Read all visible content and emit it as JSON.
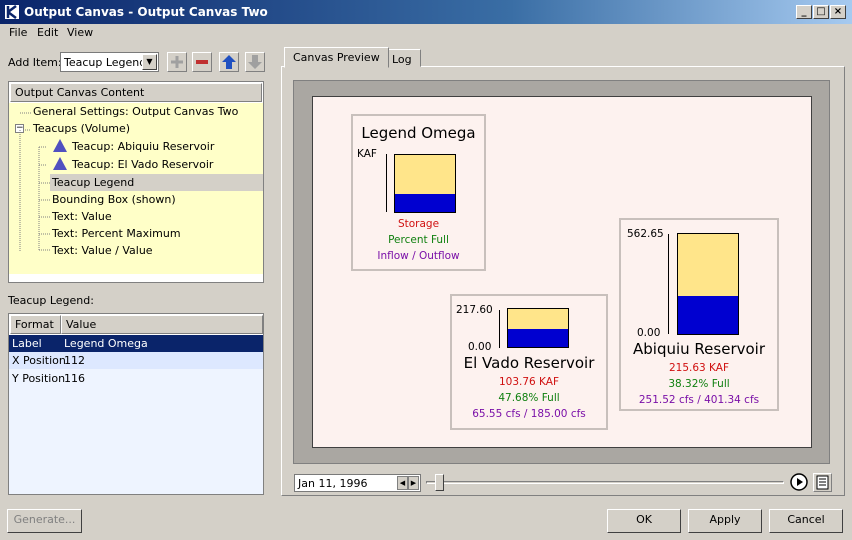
{
  "window": {
    "title": "Output Canvas - Output Canvas Two"
  },
  "menu": [
    "File",
    "Edit",
    "View"
  ],
  "add_item": {
    "label": "Add Item:",
    "selected": "Teacup Legend"
  },
  "content_tree": {
    "header": "Output Canvas Content",
    "items": [
      "General Settings: Output Canvas Two",
      "Teacups (Volume)",
      "Teacup: Abiquiu Reservoir",
      "Teacup: El Vado Reservoir",
      "Teacup Legend",
      "Bounding Box (shown)",
      "Text: Value",
      "Text: Percent Maximum",
      "Text: Value / Value"
    ],
    "collapse_glyph": "−"
  },
  "properties": {
    "title": "Teacup Legend:",
    "columns": [
      "Format",
      "Value"
    ],
    "rows": [
      {
        "format": "Label",
        "value": "Legend Omega"
      },
      {
        "format": "X Position",
        "value": "112"
      },
      {
        "format": "Y Position",
        "value": "116"
      }
    ]
  },
  "tabs": [
    "Canvas Preview",
    "Log"
  ],
  "legend": {
    "title": "Legend Omega",
    "unit": "KAF",
    "fill_fraction": 0.32,
    "lines": [
      "Storage",
      "Percent Full",
      "Inflow / Outflow"
    ]
  },
  "el_vado": {
    "name": "El Vado Reservoir",
    "max": "217.60",
    "min": "0.00",
    "fill_fraction": 0.4768,
    "lines": [
      "103.76 KAF",
      "47.68% Full",
      "65.55 cfs / 185.00 cfs"
    ]
  },
  "abiquiu": {
    "name": "Abiquiu Reservoir",
    "max": "562.65",
    "min": "0.00",
    "fill_fraction": 0.3832,
    "lines": [
      "215.63 KAF",
      "38.32% Full",
      "251.52 cfs / 401.34 cfs"
    ]
  },
  "timeline": {
    "date": "Jan 11, 1996",
    "position": 0.02
  },
  "buttons": {
    "generate": "Generate...",
    "ok": "OK",
    "apply": "Apply",
    "cancel": "Cancel"
  },
  "colors": {
    "cup_empty": "#ffe58a",
    "cup_fill": "#0000d0",
    "value_text": "#d01010",
    "percent_text": "#108010",
    "flow_text": "#7a10a8",
    "tree_highlight": "#ffffc8"
  },
  "icons": {
    "add": "plus-icon",
    "remove": "minus-icon",
    "up": "arrow-up-icon",
    "down": "arrow-down-icon",
    "teacup_item": "teacup-triangle-icon",
    "play": "play-icon",
    "menu": "list-icon"
  }
}
